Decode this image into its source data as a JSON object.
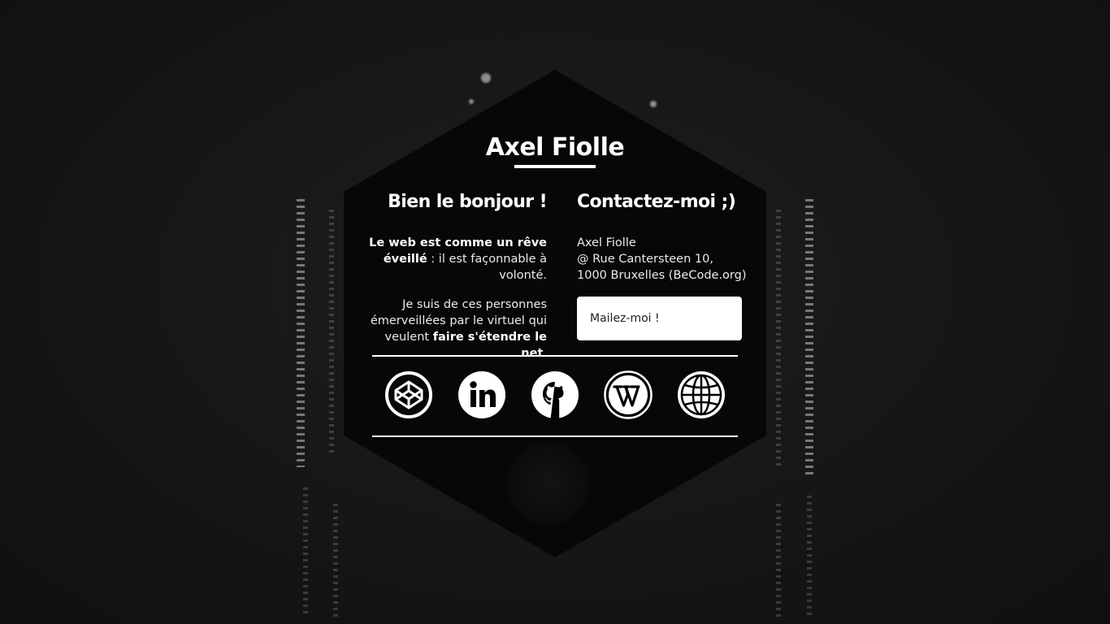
{
  "header": {
    "site_title": "Axel Fiolle"
  },
  "intro": {
    "heading": "Bien le bonjour !",
    "p1_bold": "Le web est comme un rêve éveillé",
    "p1_rest": " : il est façonnable à volonté.",
    "p2_start": "Je suis de ces personnes émerveillées par le virtuel qui veulent ",
    "p2_bold": "faire s'étendre le net",
    "p2_end": "."
  },
  "contact": {
    "heading": "Contactez-moi ;)",
    "name": "Axel Fiolle",
    "address_line1": "@ Rue Cantersteen 10,",
    "address_line2": "1000 Bruxelles (BeCode.org)",
    "mail_button_label": "Mailez-moi !"
  },
  "social": [
    {
      "icon": "codepen-icon"
    },
    {
      "icon": "linkedin-icon"
    },
    {
      "icon": "github-icon"
    },
    {
      "icon": "wordpress-icon"
    },
    {
      "icon": "globe-icon"
    }
  ],
  "colors": {
    "background": "#141414",
    "panel": "#060606",
    "text": "#ffffff",
    "button_bg": "#ffffff",
    "button_text": "#222222"
  }
}
